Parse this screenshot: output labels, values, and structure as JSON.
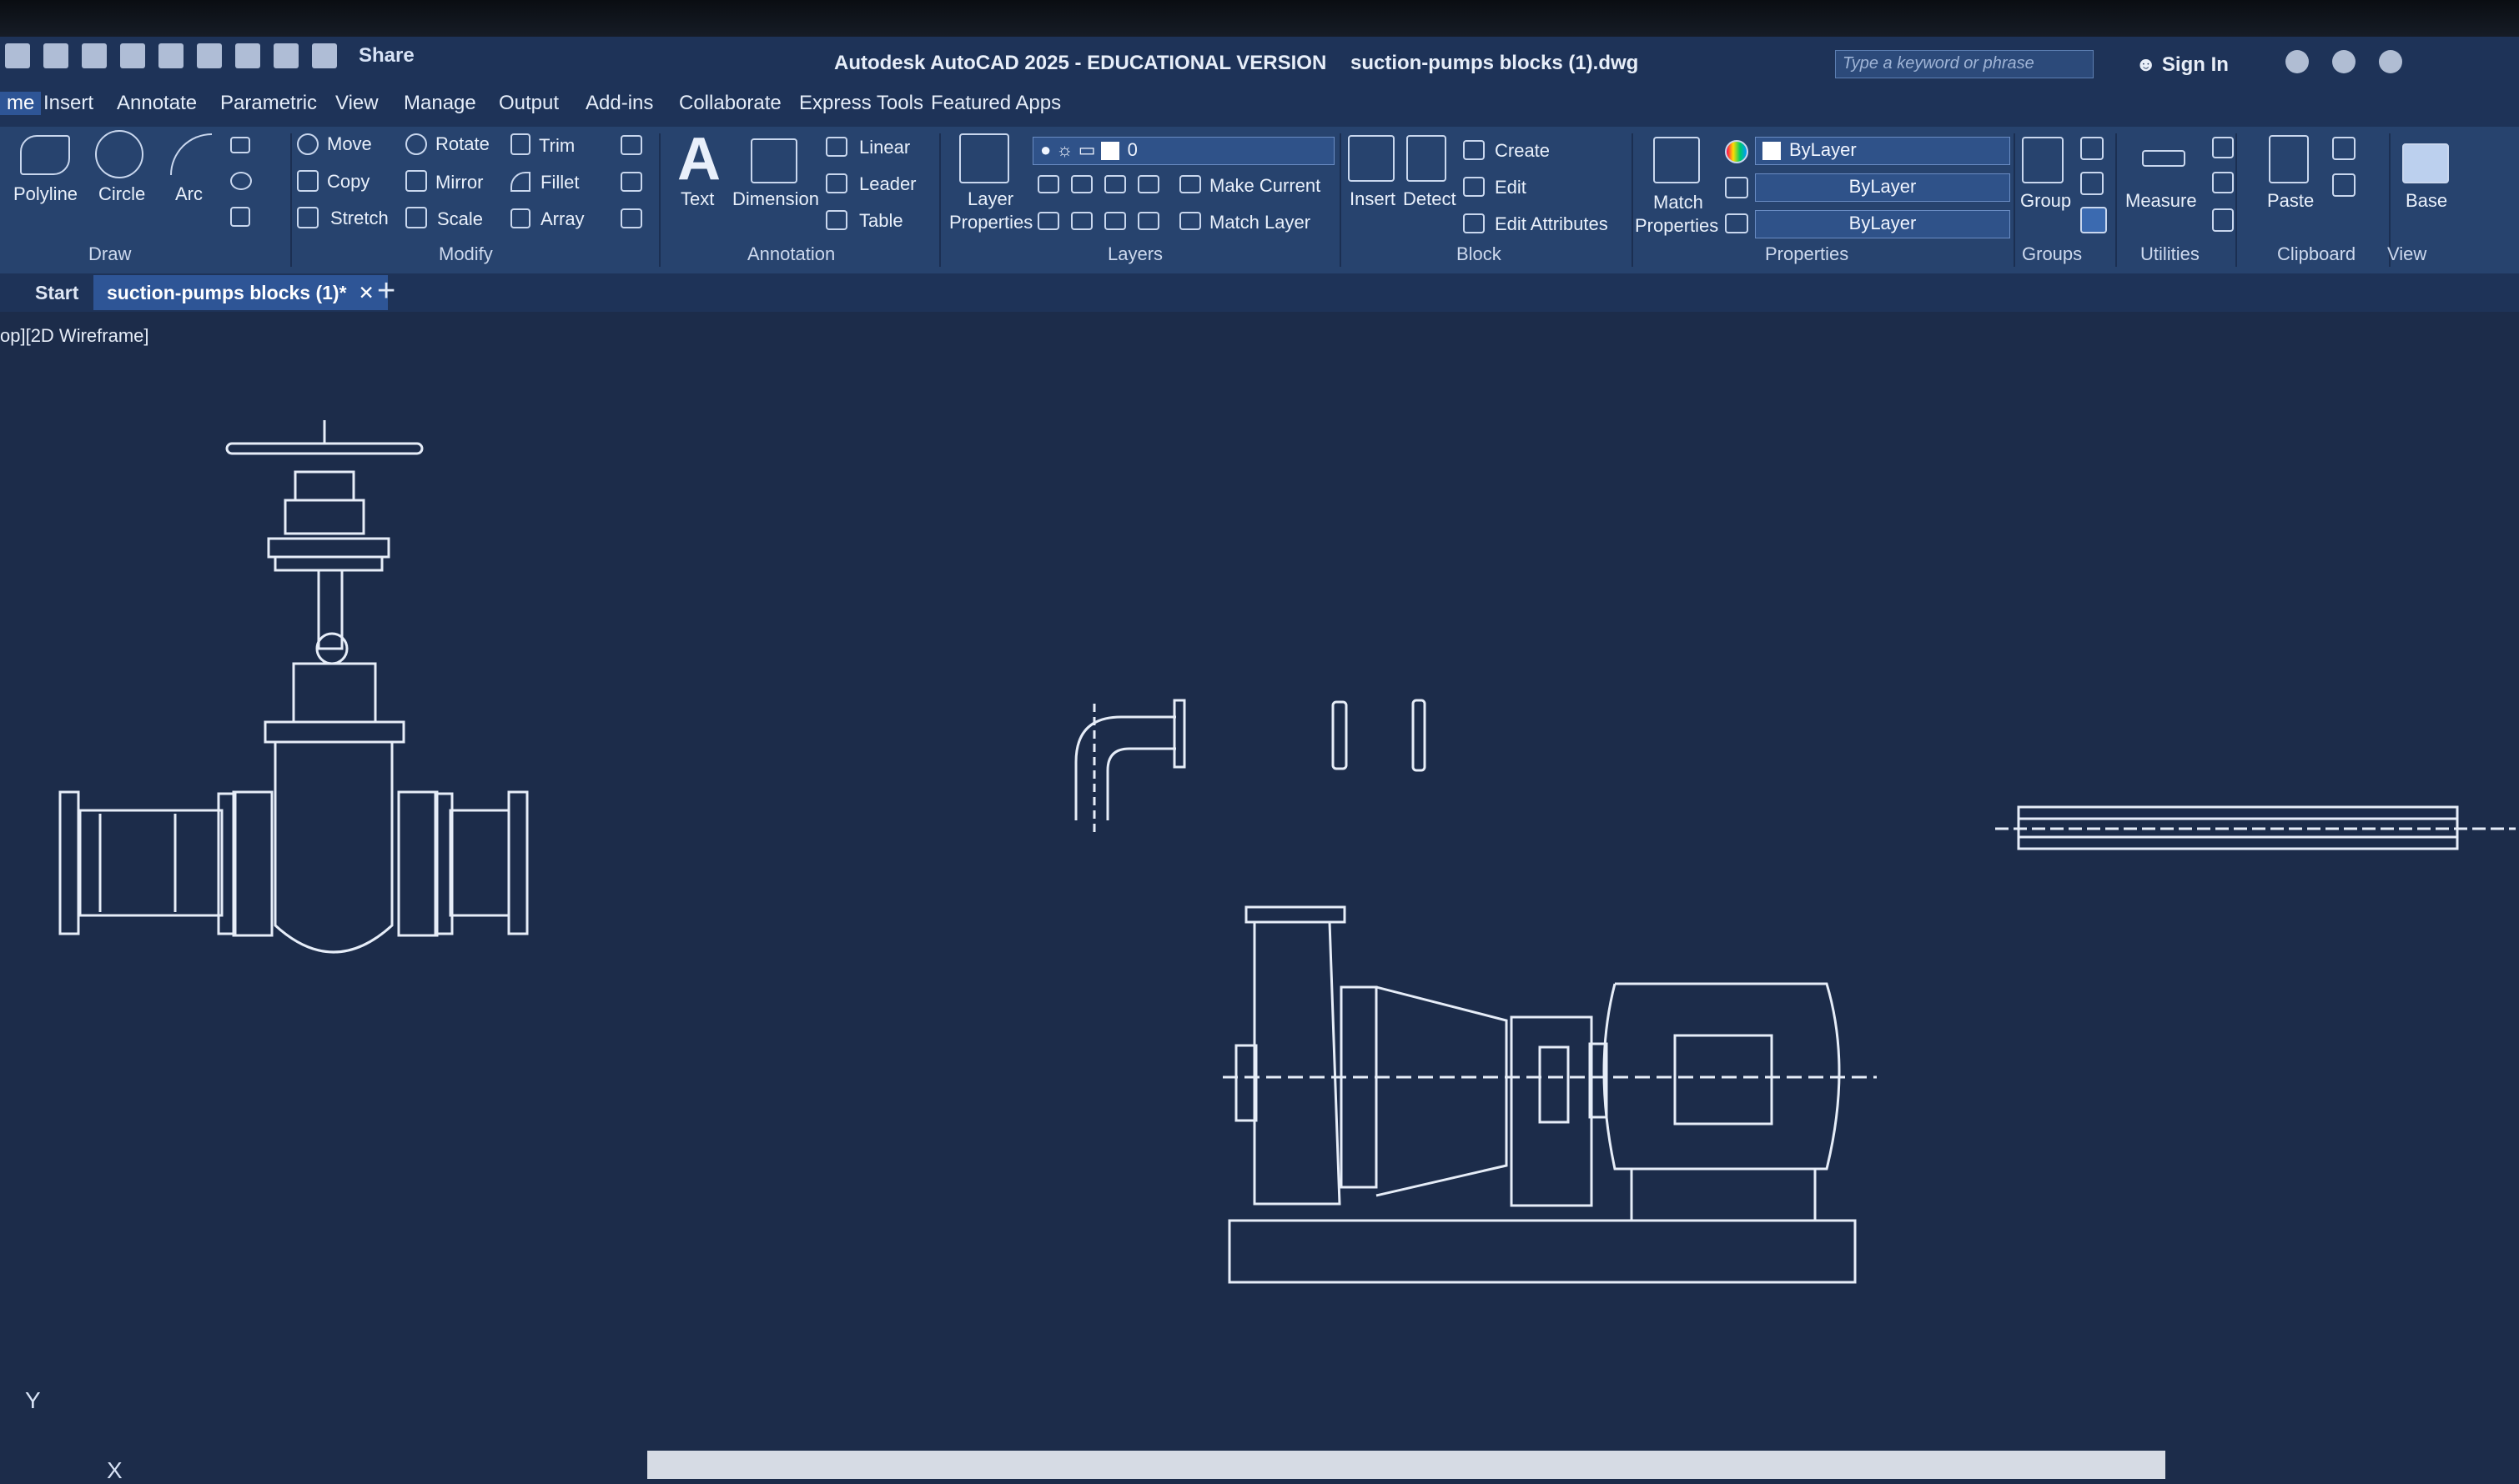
{
  "app": {
    "title": "Autodesk AutoCAD 2025 - EDUCATIONAL VERSION",
    "filename": "suction-pumps blocks (1).dwg",
    "share_label": "Share",
    "search_placeholder": "Type a keyword or phrase",
    "sign_in_label": "Sign In"
  },
  "menu": {
    "items": [
      "me",
      "Insert",
      "Annotate",
      "Parametric",
      "View",
      "Manage",
      "Output",
      "Add-ins",
      "Collaborate",
      "Express Tools",
      "Featured Apps"
    ]
  },
  "ribbon": {
    "draw": {
      "title": "Draw",
      "polyline": "Polyline",
      "circle": "Circle",
      "arc": "Arc"
    },
    "modify": {
      "title": "Modify",
      "move": "Move",
      "rotate": "Rotate",
      "trim": "Trim",
      "copy": "Copy",
      "mirror": "Mirror",
      "fillet": "Fillet",
      "stretch": "Stretch",
      "scale": "Scale",
      "array": "Array"
    },
    "annotation": {
      "title": "Annotation",
      "text": "Text",
      "dimension": "Dimension",
      "linear": "Linear",
      "leader": "Leader",
      "table": "Table"
    },
    "layers": {
      "title": "Layers",
      "layer_properties_line1": "Layer",
      "layer_properties_line2": "Properties",
      "current_layer": "0",
      "make_current": "Make Current",
      "match_layer": "Match Layer"
    },
    "block": {
      "title": "Block",
      "insert": "Insert",
      "detect": "Detect",
      "create": "Create",
      "edit": "Edit",
      "edit_attributes": "Edit Attributes"
    },
    "properties": {
      "title": "Properties",
      "match_line1": "Match",
      "match_line2": "Properties",
      "color": "ByLayer",
      "linetype": "ByLayer",
      "lineweight": "ByLayer"
    },
    "groups": {
      "title": "Groups",
      "group": "Group"
    },
    "utilities": {
      "title": "Utilities",
      "measure": "Measure"
    },
    "clipboard": {
      "title": "Clipboard",
      "paste": "Paste"
    },
    "view": {
      "title": "View",
      "base": "Base"
    }
  },
  "tabs": {
    "start": "Start",
    "active": "suction-pumps blocks (1)*"
  },
  "viewport": {
    "label": "op][2D Wireframe]",
    "ucs_y": "Y",
    "ucs_x": "X"
  }
}
